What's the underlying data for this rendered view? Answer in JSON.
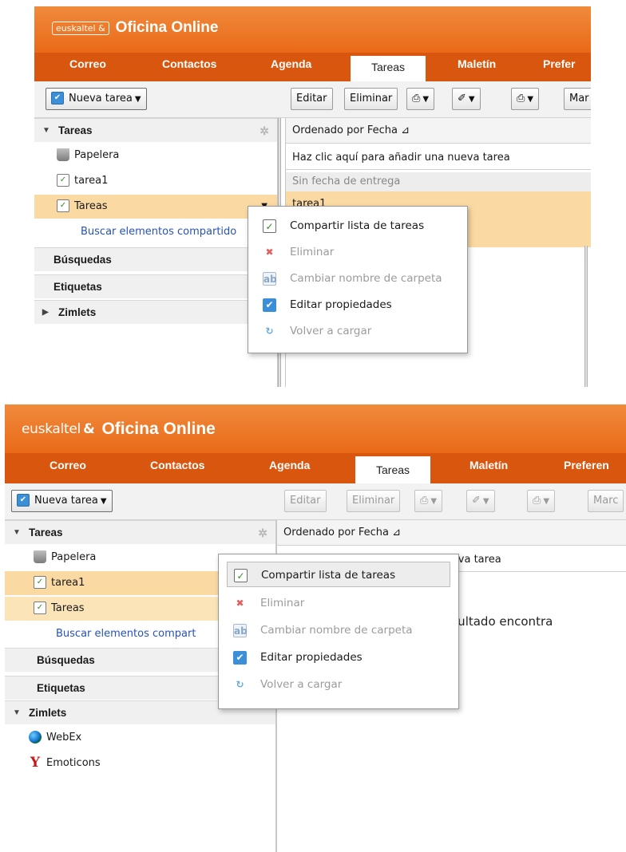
{
  "shot1": {
    "brand": {
      "logo": "euskaltel",
      "logo_mark": "&",
      "title": "Oficina Online"
    },
    "tabs": [
      "Correo",
      "Contactos",
      "Agenda",
      "Tareas",
      "Maletín",
      "Prefer"
    ],
    "toolbar": {
      "new_task": "Nueva tarea",
      "edit": "Editar",
      "delete": "Eliminar",
      "mark": "Mar"
    },
    "sidebar": {
      "tasks_header": "Tareas",
      "trash": "Papelera",
      "task1": "tarea1",
      "tasks_folder": "Tareas",
      "find_shared": "Buscar elementos compartido",
      "searches": "Búsquedas",
      "tags": "Etiquetas",
      "zimlets": "Zimlets"
    },
    "main": {
      "sort": "Ordenado por Fecha",
      "sort_arrow": "⊿",
      "new_task_prompt": "Haz clic aquí para añadir una nueva tarea",
      "group": "Sin fecha de entrega",
      "row": "tarea1"
    },
    "context_menu": [
      "Compartir lista de tareas",
      "Eliminar",
      "Cambiar nombre de carpeta",
      "Editar propiedades",
      "Volver a cargar"
    ]
  },
  "shot2": {
    "brand": {
      "logo": "euskaltel",
      "logo_mark": "&",
      "title": "Oficina Online"
    },
    "tabs": [
      "Correo",
      "Contactos",
      "Agenda",
      "Tareas",
      "Maletín",
      "Preferen"
    ],
    "toolbar": {
      "new_task": "Nueva tarea",
      "edit": "Editar",
      "delete": "Eliminar",
      "mark": "Marc"
    },
    "sidebar": {
      "tasks_header": "Tareas",
      "trash": "Papelera",
      "task1": "tarea1",
      "tasks_folder": "Tareas",
      "find_shared": "Buscar elementos compart",
      "searches": "Búsquedas",
      "tags": "Etiquetas",
      "zimlets": "Zimlets",
      "webex": "WebEx",
      "emoticons": "Emoticons"
    },
    "main": {
      "sort": "Ordenado por Fecha",
      "sort_arrow": "⊿",
      "new_task_prompt": "Haz clic aquí para añadir una nueva tarea",
      "no_results": "gún resultado encontra"
    },
    "context_menu": [
      "Compartir lista de tareas",
      "Eliminar",
      "Cambiar nombre de carpeta",
      "Editar propiedades",
      "Volver a cargar"
    ]
  },
  "colors": {
    "orange_top": "#f08a3c",
    "orange_tabs": "#d9560f",
    "selected_row": "#fbd9a3",
    "link": "#2752b8"
  },
  "icons": [
    "tasks-icon",
    "trash-icon",
    "task-icon",
    "gear-icon",
    "print-icon",
    "tag-icon",
    "move-icon",
    "share-icon",
    "delete-icon",
    "rename-icon",
    "properties-icon",
    "reload-icon",
    "webex-icon",
    "emoticons-icon"
  ]
}
